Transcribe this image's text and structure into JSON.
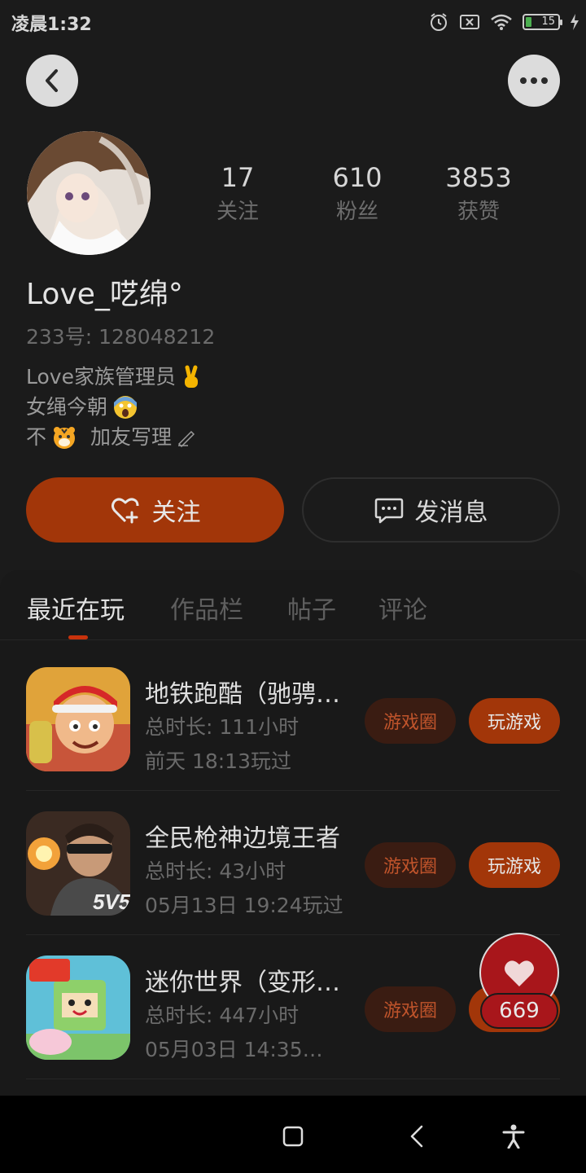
{
  "status_bar": {
    "time": "凌晨1:32",
    "battery_level": "15",
    "icons": [
      "alarm-icon",
      "sim-none-icon",
      "wifi-icon",
      "battery-icon",
      "charging-icon"
    ]
  },
  "header": {
    "back_icon": "chevron-left-icon",
    "more_icon": "more-dots-icon"
  },
  "profile": {
    "stats": [
      {
        "value": "17",
        "label": "关注"
      },
      {
        "value": "610",
        "label": "粉丝"
      },
      {
        "value": "3853",
        "label": "获赞"
      }
    ],
    "username": "Love_呓绵°",
    "uid": "233号: 128048212",
    "bio_lines": [
      "Love家族管理员✌️",
      "女绳今朝😱",
      "不🐯  加友写理✍"
    ],
    "bio_parts": {
      "line1_text": "Love家族管理员",
      "line2_text": "女绳今朝",
      "line3_a": "不",
      "line3_b": "加友写理"
    }
  },
  "actions": {
    "follow_label": "关注",
    "message_label": "发消息"
  },
  "tabs": [
    {
      "label": "最近在玩",
      "active": true
    },
    {
      "label": "作品栏",
      "active": false
    },
    {
      "label": "帖子",
      "active": false
    },
    {
      "label": "评论",
      "active": false
    }
  ],
  "games": [
    {
      "title": "地铁跑酷（驰骋…",
      "duration": "总时长: 111小时",
      "last_played": "前天 18:13玩过",
      "circle_label": "游戏圈",
      "play_label": "玩游戏"
    },
    {
      "title": "全民枪神边境王者",
      "duration": "总时长: 43小时",
      "last_played": "05月13日 19:24玩过",
      "circle_label": "游戏圈",
      "play_label": "玩游戏"
    },
    {
      "title": "迷你世界（变形…",
      "duration": "总时长: 447小时",
      "last_played": "05月03日 14:35…",
      "circle_label": "游戏圈",
      "play_label": "玩游戏"
    }
  ],
  "like_fab": {
    "count": "669"
  },
  "colors": {
    "accent": "#a23609",
    "like": "#a8161b",
    "background": "#1b1b1b"
  }
}
